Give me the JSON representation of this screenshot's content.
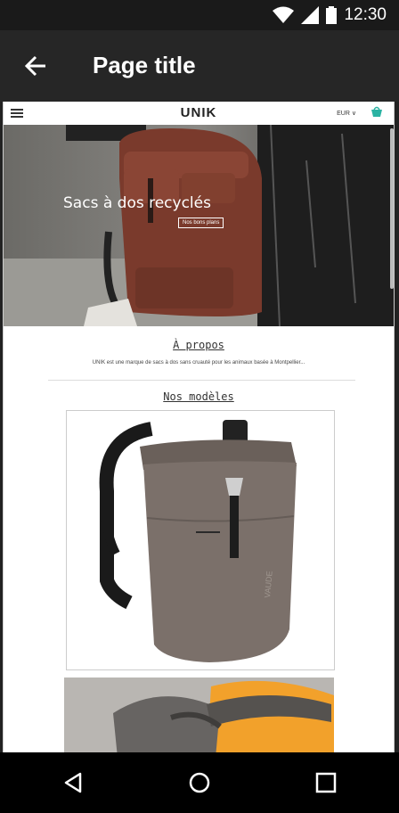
{
  "status_bar": {
    "time": "12:30"
  },
  "app_bar": {
    "title": "Page title"
  },
  "site": {
    "logo": "UNIK",
    "currency": "EUR ∨",
    "hero": {
      "title": "Sacs à dos recyclés",
      "button": "Nos bons plans"
    },
    "about": {
      "title": "À propos",
      "text": "UNIK est une marque de sacs à dos sans cruauté pour les animaux basée à Montpellier..."
    },
    "models": {
      "title": "Nos modèles"
    }
  },
  "colors": {
    "status_bar": "#1a1a1a",
    "app_bar": "#262626",
    "bag_red": "#7a3a2c",
    "bag_gray": "#7b706a",
    "accent_cart": "#2bb3a3"
  },
  "icons": [
    "wifi-icon",
    "signal-icon",
    "battery-icon",
    "back-arrow-icon",
    "menu-icon",
    "cart-icon",
    "nav-back-icon",
    "nav-home-icon",
    "nav-recents-icon"
  ]
}
